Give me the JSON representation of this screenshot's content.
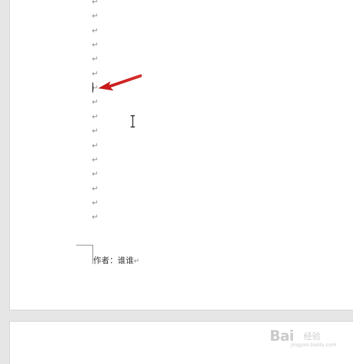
{
  "document": {
    "paragraph_mark": "↵",
    "empty_paragraph_count": 16,
    "author_line": {
      "text": "作者：谁谁",
      "paragraph_mark": "↵"
    }
  },
  "annotations": {
    "arrow_color": "#d62020",
    "arrow_target": "text-caret"
  },
  "watermark": {
    "logo_text": "Bai",
    "sub_text": "经验",
    "url_text": "jingyan.baidu.com"
  },
  "colors": {
    "workspace_bg": "#e6e6e6",
    "page_bg": "#ffffff",
    "formatting_mark": "#8a8a8a"
  }
}
